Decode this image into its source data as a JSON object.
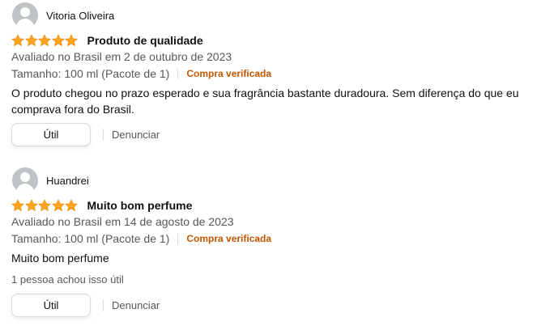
{
  "reviews": [
    {
      "reviewer": "Vitoria Oliveira",
      "rating": 5,
      "title": "Produto de qualidade",
      "date": "Avaliado no Brasil em 2 de outubro de 2023",
      "variant": "Tamanho: 100 ml (Pacote de 1)",
      "verified": "Compra verificada",
      "text": "O produto chegou no prazo esperado e sua fragrância bastante duradoura. Sem diferença do que eu comprava fora do Brasil.",
      "helpful_button": "Útil",
      "report": "Denunciar"
    },
    {
      "reviewer": "Huandrei",
      "rating": 5,
      "title": "Muito bom perfume",
      "date": "Avaliado no Brasil em 14 de agosto de 2023",
      "variant": "Tamanho: 100 ml (Pacote de 1)",
      "verified": "Compra verificada",
      "text": "Muito bom perfume",
      "helpful_count": "1 pessoa achou isso útil",
      "helpful_button": "Útil",
      "report": "Denunciar"
    }
  ],
  "colors": {
    "star": "#ffa41c",
    "verified": "#c45500",
    "muted": "#565959"
  }
}
